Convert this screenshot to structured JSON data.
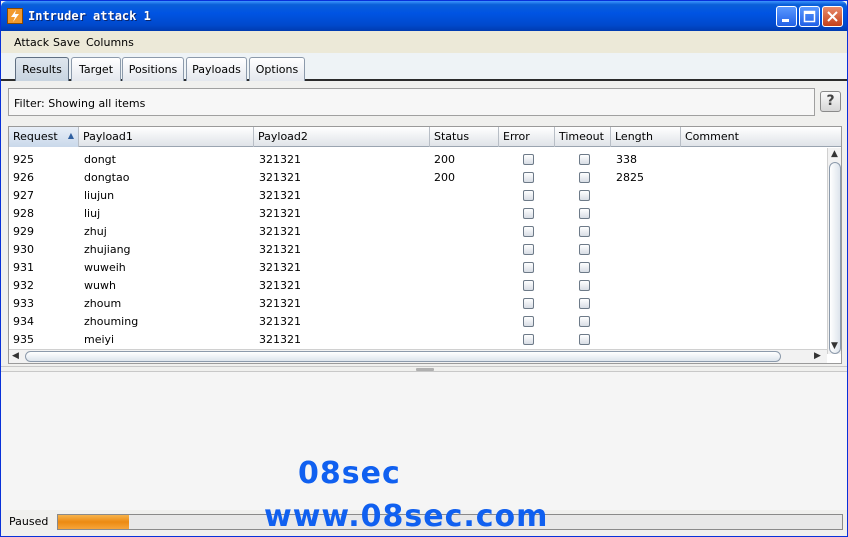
{
  "window": {
    "title": "Intruder attack 1"
  },
  "menu": [
    "Attack",
    "Save",
    "Columns"
  ],
  "tabs": [
    {
      "label": "Results",
      "active": true
    },
    {
      "label": "Target"
    },
    {
      "label": "Positions"
    },
    {
      "label": "Payloads"
    },
    {
      "label": "Options"
    }
  ],
  "filter": {
    "text": "Filter:  Showing all items",
    "help": "?"
  },
  "table": {
    "columns": [
      "Request",
      "Payload1",
      "Payload2",
      "Status",
      "Error",
      "Timeout",
      "Length",
      "Comment"
    ],
    "sort_column": "Request",
    "sort_direction": "ascending",
    "rows": [
      {
        "request": "925",
        "payload1": "dongt",
        "payload2": "321321",
        "status": "200",
        "length": "338"
      },
      {
        "request": "926",
        "payload1": "dongtao",
        "payload2": "321321",
        "status": "200",
        "length": "2825"
      },
      {
        "request": "927",
        "payload1": "liujun",
        "payload2": "321321",
        "status": "",
        "length": ""
      },
      {
        "request": "928",
        "payload1": "liuj",
        "payload2": "321321",
        "status": "",
        "length": ""
      },
      {
        "request": "929",
        "payload1": "zhuj",
        "payload2": "321321",
        "status": "",
        "length": ""
      },
      {
        "request": "930",
        "payload1": "zhujiang",
        "payload2": "321321",
        "status": "",
        "length": ""
      },
      {
        "request": "931",
        "payload1": "wuweih",
        "payload2": "321321",
        "status": "",
        "length": ""
      },
      {
        "request": "932",
        "payload1": "wuwh",
        "payload2": "321321",
        "status": "",
        "length": ""
      },
      {
        "request": "933",
        "payload1": "zhoum",
        "payload2": "321321",
        "status": "",
        "length": ""
      },
      {
        "request": "934",
        "payload1": "zhouming",
        "payload2": "321321",
        "status": "",
        "length": ""
      },
      {
        "request": "935",
        "payload1": "meiyi",
        "payload2": "321321",
        "status": "",
        "length": ""
      }
    ]
  },
  "status": {
    "text": "Paused",
    "progress": 0.09
  },
  "watermark": {
    "line1": "08sec",
    "line2": "www.08sec.com"
  },
  "colors": {
    "title_bar": "#0054e3",
    "progress": "#ec8a12",
    "watermark": "#1060f0"
  }
}
